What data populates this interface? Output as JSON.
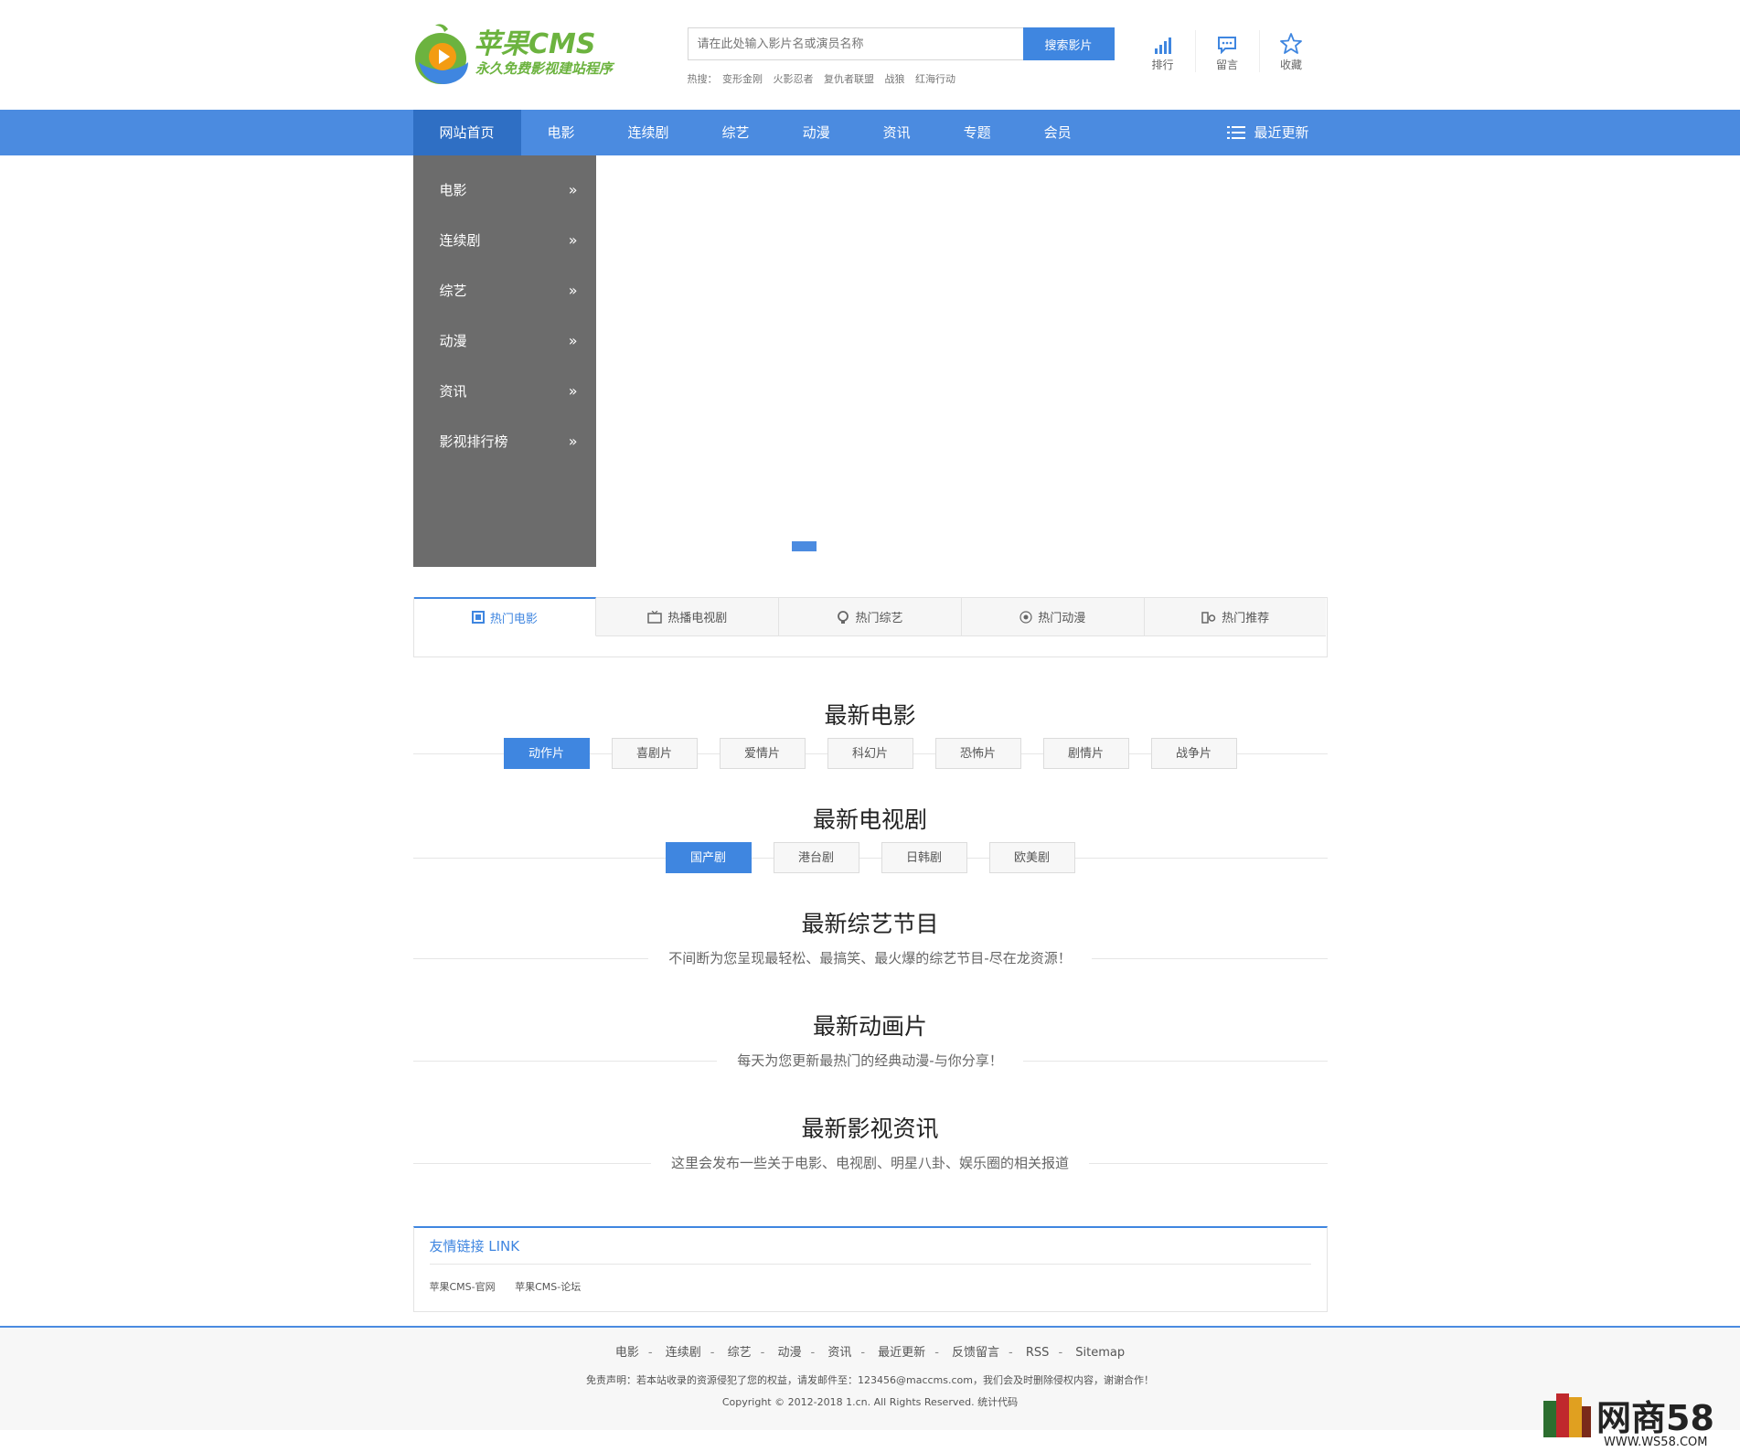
{
  "logo": {
    "brand": "苹果CMS",
    "slogan": "永久免费影视建站程序"
  },
  "search": {
    "placeholder": "请在此处输入影片名或演员名称",
    "button": "搜索影片"
  },
  "hot": {
    "label": "热搜：",
    "items": [
      "变形金刚",
      "火影忍者",
      "复仇者联盟",
      "战狼",
      "红海行动"
    ]
  },
  "tools": [
    {
      "label": "排行",
      "icon": "bar-chart-icon"
    },
    {
      "label": "留言",
      "icon": "message-icon"
    },
    {
      "label": "收藏",
      "icon": "star-icon"
    }
  ],
  "nav": {
    "items": [
      "网站首页",
      "电影",
      "连续剧",
      "综艺",
      "动漫",
      "资讯",
      "专题",
      "会员"
    ],
    "active": "网站首页",
    "recent": "最近更新"
  },
  "side_menu": [
    "电影",
    "连续剧",
    "综艺",
    "动漫",
    "资讯",
    "影视排行榜"
  ],
  "tabs": [
    {
      "label": "热门电影",
      "icon": "film-icon"
    },
    {
      "label": "热播电视剧",
      "icon": "tv-icon"
    },
    {
      "label": "热门综艺",
      "icon": "variety-icon"
    },
    {
      "label": "热门动漫",
      "icon": "anime-icon"
    },
    {
      "label": "热门推荐",
      "icon": "recommend-icon"
    }
  ],
  "sections": {
    "movies": {
      "title": "最新电影",
      "buttons": [
        "动作片",
        "喜剧片",
        "爱情片",
        "科幻片",
        "恐怖片",
        "剧情片",
        "战争片"
      ]
    },
    "tv": {
      "title": "最新电视剧",
      "buttons": [
        "国产剧",
        "港台剧",
        "日韩剧",
        "欧美剧"
      ]
    },
    "variety": {
      "title": "最新综艺节目",
      "subtitle": "不间断为您呈现最轻松、最搞笑、最火爆的综艺节目-尽在龙资源！"
    },
    "anime": {
      "title": "最新动画片",
      "subtitle": "每天为您更新最热门的经典动漫-与你分享！"
    },
    "news": {
      "title": "最新影视资讯",
      "subtitle": "这里会发布一些关于电影、电视剧、明星八卦、娱乐圈的相关报道"
    }
  },
  "links": {
    "title": "友情链接 LINK",
    "items": [
      "苹果CMS-官网",
      "苹果CMS-论坛"
    ]
  },
  "footer": {
    "nav": [
      "电影",
      "连续剧",
      "综艺",
      "动漫",
      "资讯",
      "最近更新",
      "反馈留言",
      "RSS",
      "Sitemap"
    ],
    "disclaimer": "免责声明：若本站收录的资源侵犯了您的权益，请发邮件至：123456@maccms.com，我们会及时删除侵权内容，谢谢合作！",
    "copyright": "Copyright © 2012-2018 1.cn. All Rights Reserved. 统计代码"
  },
  "watermark": {
    "text": "网商58",
    "url": "WWW.WS58.COM"
  },
  "colors": {
    "accent": "#3f86e0",
    "nav": "#4b8be0",
    "side": "#6c6c6c",
    "logo_green": "#6cb33f"
  }
}
